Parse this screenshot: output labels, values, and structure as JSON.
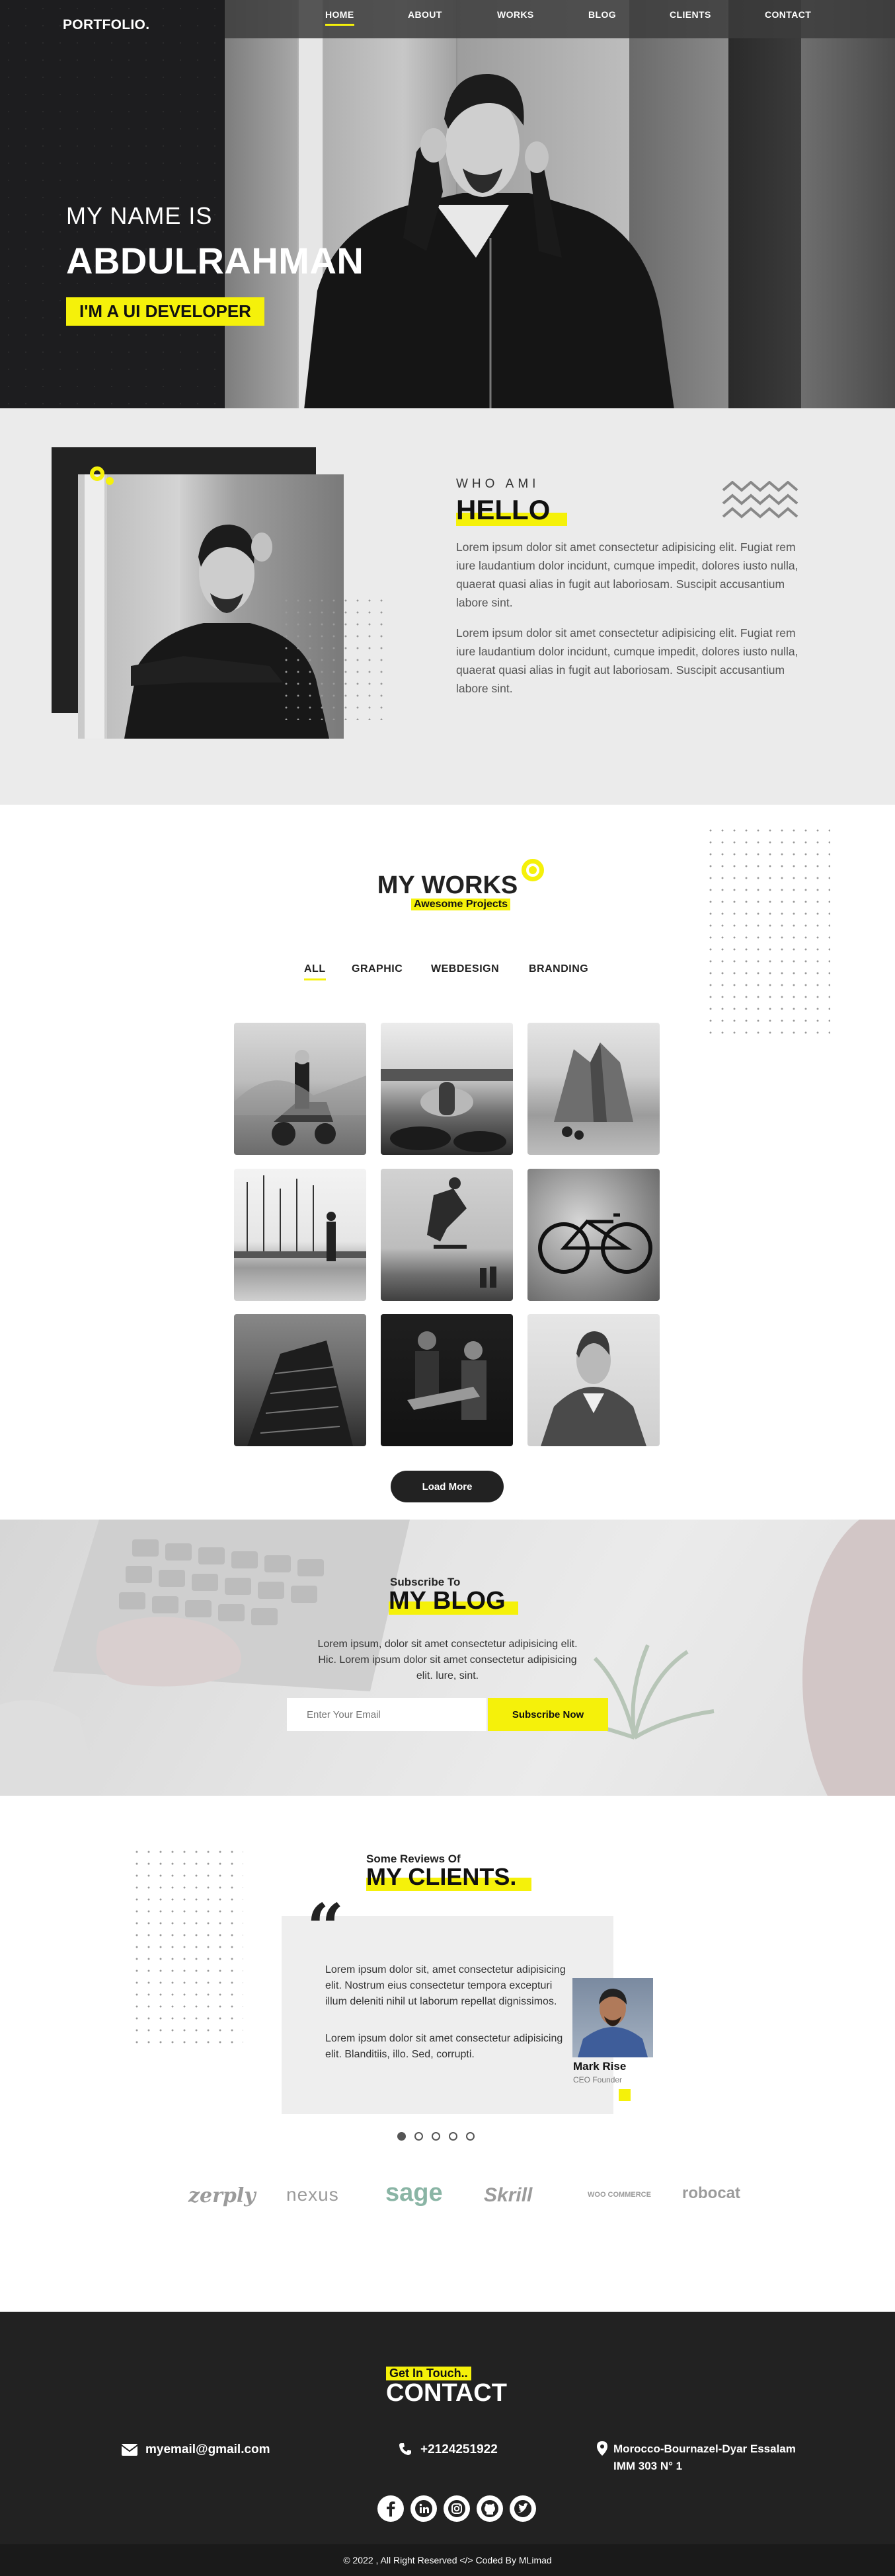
{
  "nav": {
    "logo": "PORTFOLIO.",
    "items": [
      {
        "label": "HOME",
        "active": true
      },
      {
        "label": "ABOUT",
        "active": false
      },
      {
        "label": "WORKS",
        "active": false
      },
      {
        "label": "BLOG",
        "active": false
      },
      {
        "label": "CLIENTS",
        "active": false
      },
      {
        "label": "CONTACT",
        "active": false
      }
    ]
  },
  "hero": {
    "greeting": "MY NAME IS",
    "name": "ABDULRAHMAN",
    "role": "I'M A UI DEVELOPER"
  },
  "about": {
    "tag": "WHO AMI",
    "title": "HELLO",
    "paragraphs": [
      "Lorem ipsum dolor sit amet consectetur adipisicing elit. Fugiat rem iure laudantium dolor incidunt, cumque impedit, dolores iusto nulla, quaerat quasi alias in fugit aut laboriosam. Suscipit accusantium labore sint.",
      "Lorem ipsum dolor sit amet consectetur adipisicing elit. Fugiat rem iure laudantium dolor incidunt, cumque impedit, dolores iusto nulla, quaerat quasi alias in fugit aut laboriosam. Suscipit accusantium labore sint."
    ]
  },
  "works": {
    "title": "MY WORKS",
    "subtitle": "Awesome Projects",
    "filters": [
      {
        "label": "ALL",
        "active": true
      },
      {
        "label": "GRAPHIC",
        "active": false
      },
      {
        "label": "WEBDESIGN",
        "active": false
      },
      {
        "label": "BRANDING",
        "active": false
      }
    ],
    "gallery": [
      {
        "subject": "scooter"
      },
      {
        "subject": "feet-on-blanket"
      },
      {
        "subject": "mountain-rocks"
      },
      {
        "subject": "sailboats"
      },
      {
        "subject": "skater"
      },
      {
        "subject": "bicycle"
      },
      {
        "subject": "skyscraper"
      },
      {
        "subject": "guitarist"
      },
      {
        "subject": "man-portrait"
      }
    ],
    "load_more": "Load More"
  },
  "blog": {
    "pre_title": "Subscribe To",
    "title": "MY BLOG",
    "text": "Lorem ipsum, dolor sit amet consectetur adipisicing elit. Hic. Lorem ipsum dolor sit amet consectetur adipisicing elit. lure, sint.",
    "email_placeholder": "Enter Your Email",
    "button": "Subscribe Now"
  },
  "clients": {
    "pre_title": "Some Reviews Of",
    "title": "MY CLIENTS.",
    "review": {
      "paragraphs": [
        "Lorem ipsum dolor sit, amet consectetur adipisicing elit. Nostrum eius consectetur tempora excepturi illum deleniti nihil ut laborum repellat dignissimos.",
        "Lorem ipsum dolor sit amet consectetur adipisicing elit. Blanditiis, illo. Sed, corrupti."
      ],
      "name": "Mark Rise",
      "role": "CEO Founder"
    },
    "carousel": {
      "count": 5,
      "active_index": 0
    },
    "partners": [
      "zerply",
      "nexus",
      "sage",
      "Skrill",
      "WOO COMMERCE",
      "robocat"
    ]
  },
  "contact": {
    "pre_title": "Get In Touch..",
    "title": "CONTACT",
    "email": "myemail@gmail.com",
    "phone": "+2124251922",
    "address_line1": "Morocco-Bournazel-Dyar Essalam",
    "address_line2": "IMM 303 N° 1",
    "socials": [
      "facebook-icon",
      "linkedin-icon",
      "instagram-icon",
      "github-icon",
      "twitter-icon"
    ],
    "copyright": "© 2022 , All Right Reserved </> Coded By MLimad"
  },
  "colors": {
    "accent": "#f5f10a",
    "dark": "#222222",
    "light_bg": "#ebebeb"
  }
}
